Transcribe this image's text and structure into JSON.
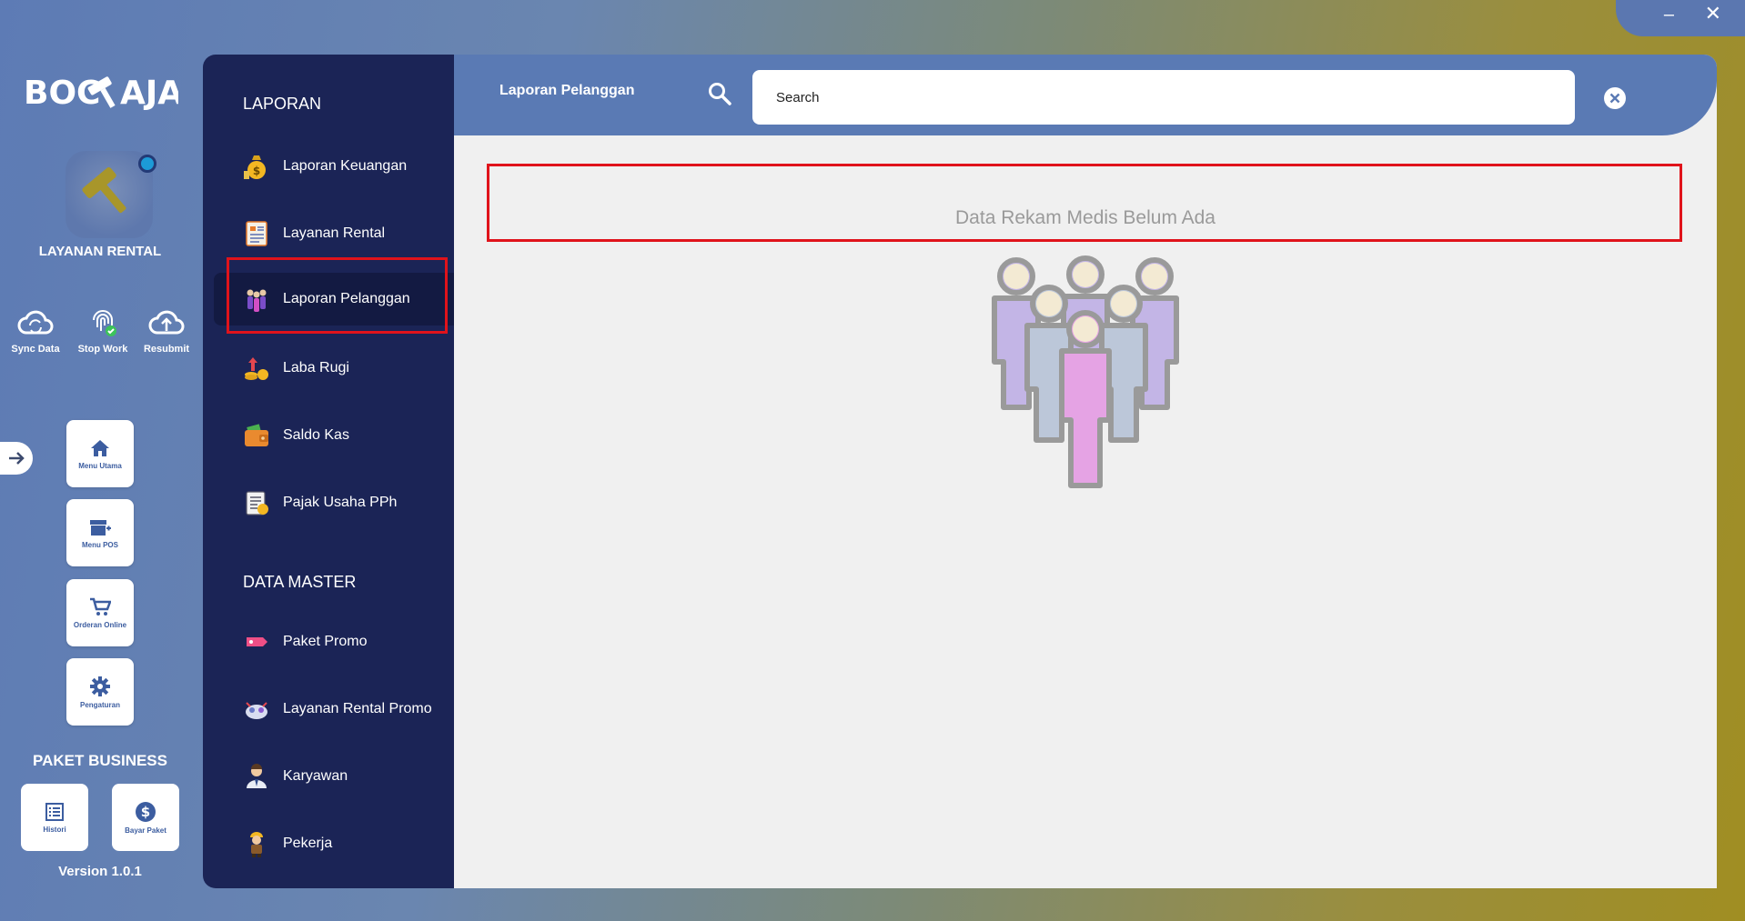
{
  "window": {
    "minimize_label": "–",
    "close_label": "✕"
  },
  "brand": {
    "logo_text": "BOC AJA",
    "label": "LAYANAN RENTAL"
  },
  "quick_actions": [
    {
      "label": "Sync Data",
      "icon": "cloud-sync-icon"
    },
    {
      "label": "Stop Work",
      "icon": "fingerprint-icon"
    },
    {
      "label": "Resubmit",
      "icon": "cloud-upload-icon"
    }
  ],
  "menu_tiles": [
    {
      "label": "Menu Utama",
      "icon": "home-icon"
    },
    {
      "label": "Menu POS",
      "icon": "store-icon"
    },
    {
      "label": "Orderan Online",
      "icon": "cart-icon"
    },
    {
      "label": "Pengaturan",
      "icon": "gear-icon"
    }
  ],
  "package": {
    "title": "PAKET BUSINESS",
    "tiles": [
      {
        "label": "Histori",
        "icon": "list-icon"
      },
      {
        "label": "Bayar Paket",
        "icon": "dollar-icon"
      }
    ],
    "version": "Version 1.0.1"
  },
  "nav": {
    "sections": [
      {
        "title": "LAPORAN"
      },
      {
        "title": "DATA MASTER"
      }
    ],
    "laporan_items": [
      {
        "label": "Laporan Keuangan",
        "icon": "money-bag-icon"
      },
      {
        "label": "Layanan Rental",
        "icon": "report-icon"
      },
      {
        "label": "Laporan Pelanggan",
        "icon": "customers-icon"
      },
      {
        "label": "Laba Rugi",
        "icon": "profit-icon"
      },
      {
        "label": "Saldo Kas",
        "icon": "wallet-icon"
      },
      {
        "label": "Pajak Usaha PPh",
        "icon": "tax-icon"
      }
    ],
    "master_items": [
      {
        "label": "Paket Promo",
        "icon": "promo-tag-icon"
      },
      {
        "label": "Layanan Rental Promo",
        "icon": "promo-service-icon"
      },
      {
        "label": "Karyawan",
        "icon": "employee-icon"
      },
      {
        "label": "Pekerja",
        "icon": "worker-icon"
      }
    ],
    "active_item": "Laporan Pelanggan"
  },
  "header": {
    "title": "Laporan Pelanggan",
    "search_placeholder": "Search",
    "search_value": ""
  },
  "content": {
    "empty_message": "Data Rekam Medis Belum Ada"
  },
  "colors": {
    "nav_bg": "#1b2456",
    "header_bg": "#5a7ab4",
    "highlight": "#e0131b",
    "accent_gold": "#a8962a"
  }
}
